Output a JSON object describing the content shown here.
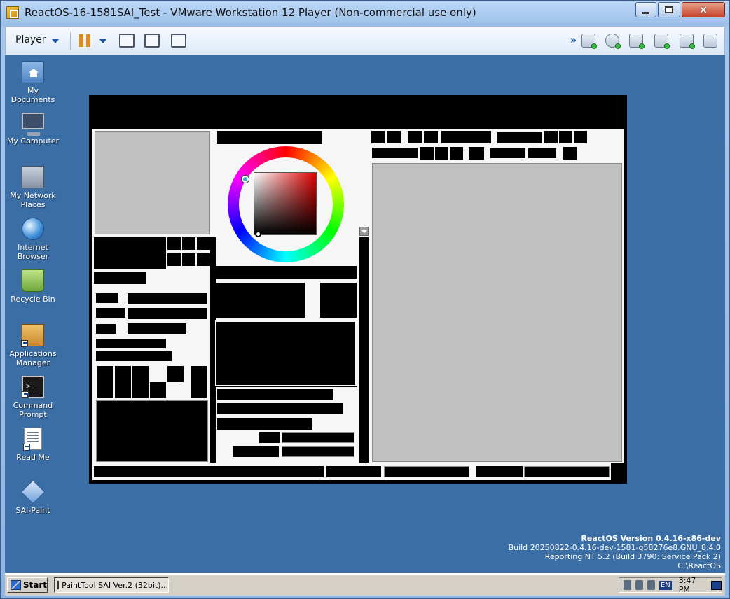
{
  "vmware": {
    "title": "ReactOS-16-1581SAI_Test - VMware Workstation 12 Player (Non-commercial use only)",
    "player_menu": "Player"
  },
  "desktop_icons": [
    {
      "label": "My Documents",
      "icon": "documents-icon"
    },
    {
      "label": "My Computer",
      "icon": "computer-icon"
    },
    {
      "label": "My Network Places",
      "icon": "network-icon"
    },
    {
      "label": "Internet Browser",
      "icon": "browser-icon"
    },
    {
      "label": "Recycle Bin",
      "icon": "recycle-bin-icon"
    },
    {
      "label": "Applications Manager",
      "icon": "applications-manager-icon"
    },
    {
      "label": "Command Prompt",
      "icon": "command-prompt-icon"
    },
    {
      "label": "Read Me",
      "icon": "readme-icon"
    },
    {
      "label": "SAI-Paint",
      "icon": "sai-paint-icon"
    }
  ],
  "watermark": {
    "line1": "ReactOS Version 0.4.16-x86-dev",
    "line2": "Build 20250822-0.4.16-dev-1581-g58276e8.GNU_8.4.0",
    "line3": "Reporting NT 5.2 (Build 3790: Service Pack 2)",
    "line4": "C:\\ReactOS"
  },
  "taskbar": {
    "start_label": "Start",
    "task_label": "PaintTool SAI Ver.2 (32bit)...",
    "lang": "EN",
    "clock": "3:47 PM"
  },
  "colors": {
    "desktop": "#3a6ea5",
    "accent": "#1c55a8"
  }
}
